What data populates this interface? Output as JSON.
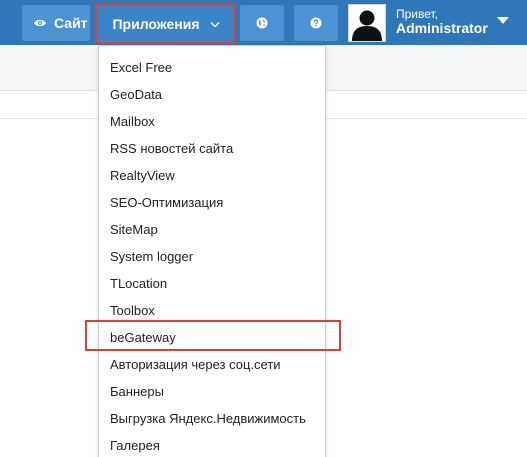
{
  "header": {
    "site_label": "Сайт",
    "apps_label": "Приложения",
    "greeting": "Привет,",
    "username": "Administrator"
  },
  "icons": {
    "site": "eye-icon",
    "apps": "chevron-down-icon",
    "globe": "globe-icon",
    "help": "question-icon",
    "user": "avatar",
    "user_menu": "caret-down-icon"
  },
  "colors": {
    "topbar": "#2f77b8",
    "button": "#4d92d2",
    "highlight": "#e0402f"
  },
  "apps_menu": {
    "items": [
      {
        "label": "Excel Free"
      },
      {
        "label": "GeoData"
      },
      {
        "label": "Mailbox"
      },
      {
        "label": "RSS новостей сайта"
      },
      {
        "label": "RealtyView"
      },
      {
        "label": "SEO-Оптимизация"
      },
      {
        "label": "SiteMap"
      },
      {
        "label": "System logger"
      },
      {
        "label": "TLocation"
      },
      {
        "label": "Toolbox"
      },
      {
        "label": "beGateway"
      },
      {
        "label": "Авторизация через соц.сети"
      },
      {
        "label": "Баннеры"
      },
      {
        "label": "Выгрузка Яндекс.Недвижимость"
      },
      {
        "label": "Галерея"
      }
    ]
  }
}
